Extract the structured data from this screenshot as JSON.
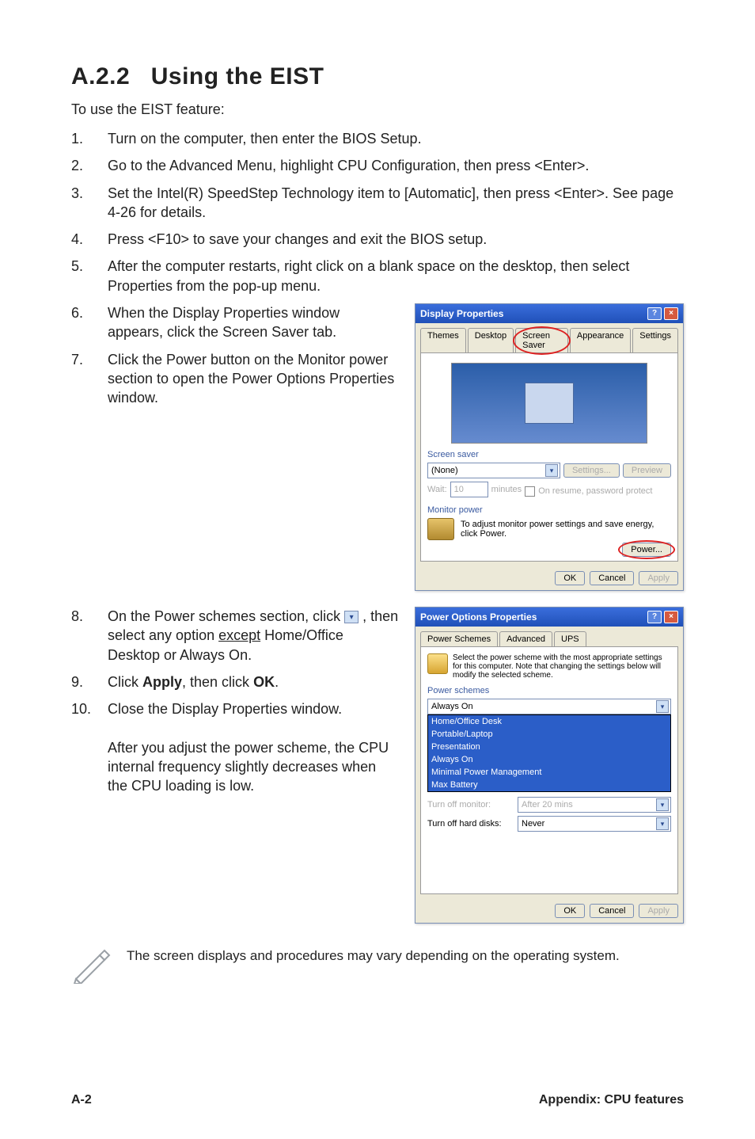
{
  "heading": {
    "number": "A.2.2",
    "title": "Using the EIST"
  },
  "intro": "To use the EIST feature:",
  "steps": [
    {
      "n": "1.",
      "t": "Turn on the computer, then enter the BIOS Setup."
    },
    {
      "n": "2.",
      "t": "Go to the Advanced Menu, highlight CPU Configuration, then press <Enter>."
    },
    {
      "n": "3.",
      "t": "Set the Intel(R) SpeedStep Technology item to [Automatic], then press <Enter>. See page 4-26 for details."
    },
    {
      "n": "4.",
      "t": "Press <F10> to save your changes and exit the BIOS setup."
    },
    {
      "n": "5.",
      "t": "After the computer restarts, right click on a blank space on the desktop, then select Properties from the pop-up menu."
    },
    {
      "n": "6.",
      "t": "When the Display Properties window appears, click the Screen Saver tab."
    },
    {
      "n": "7.",
      "t": "Click the Power button on the Monitor power section to open the Power Options Properties window."
    }
  ],
  "steps2": [
    {
      "n": "8.",
      "pre": "On the Power schemes section, click ",
      "post": ", then select any option ",
      "excl": "except",
      "tail": " Home/Office Desktop or Always On."
    },
    {
      "n": "9.",
      "t_pre": "Click ",
      "t_apply": "Apply",
      "t_mid": ", then click ",
      "t_ok": "OK",
      "t_post": "."
    },
    {
      "n": "10.",
      "t": "Close the Display Properties window.",
      "after": "After you adjust the power scheme, the CPU internal frequency slightly decreases when the CPU loading is low."
    }
  ],
  "note": "The screen displays and procedures may vary depending on the operating system.",
  "footer": {
    "left": "A-2",
    "right": "Appendix: CPU features"
  },
  "dlg1": {
    "title": "Display Properties",
    "help": "?",
    "close": "×",
    "tabs": [
      "Themes",
      "Desktop",
      "Screen Saver",
      "Appearance",
      "Settings"
    ],
    "screensaver_label": "Screen saver",
    "screensaver_value": "(None)",
    "settings_btn": "Settings...",
    "preview_btn": "Preview",
    "wait_label": "Wait:",
    "wait_value": "10",
    "wait_min": "minutes",
    "resume": "On resume, password protect",
    "monitor_label": "Monitor power",
    "monitor_text": "To adjust monitor power settings and save energy, click Power.",
    "power_btn": "Power...",
    "ok": "OK",
    "cancel": "Cancel",
    "apply": "Apply"
  },
  "dlg2": {
    "title": "Power Options Properties",
    "help": "?",
    "close": "×",
    "tabs": [
      "Power Schemes",
      "Advanced",
      "UPS"
    ],
    "desc": "Select the power scheme with the most appropriate settings for this computer. Note that changing the settings below will modify the selected scheme.",
    "scheme_label": "Power schemes",
    "scheme_selected": "Always On",
    "scheme_options": [
      "Home/Office Desk",
      "Portable/Laptop",
      "Presentation",
      "Always On",
      "Minimal Power Management",
      "Max Battery"
    ],
    "monoff_label": "Turn off monitor:",
    "monoff_val": "After 20 mins",
    "hdoff_label": "Turn off hard disks:",
    "hdoff_val": "Never",
    "ok": "OK",
    "cancel": "Cancel",
    "apply": "Apply"
  }
}
